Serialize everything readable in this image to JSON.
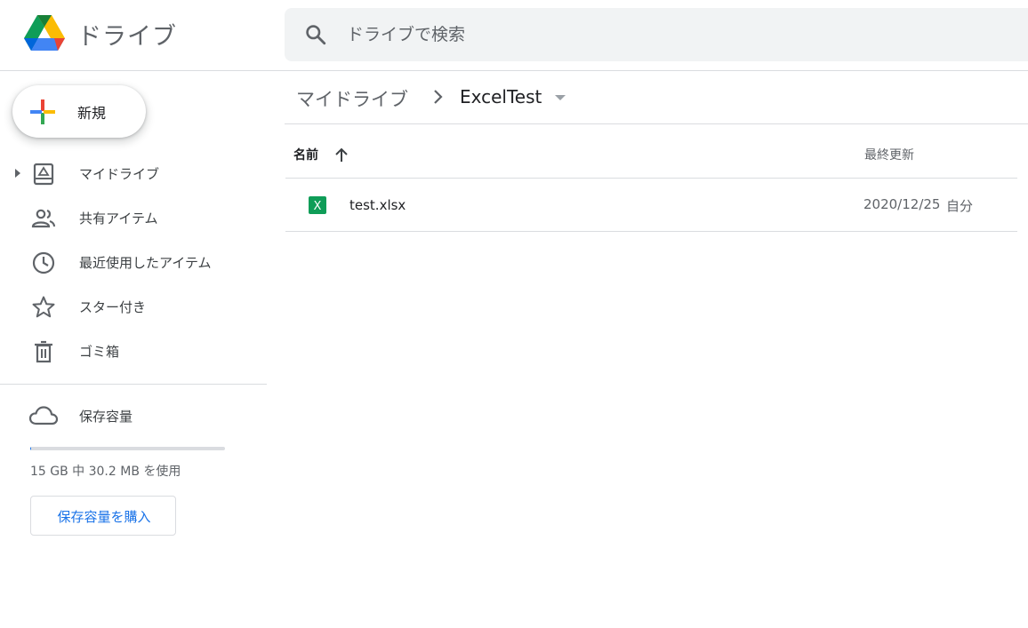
{
  "header": {
    "app_title": "ドライブ",
    "search_placeholder": "ドライブで検索"
  },
  "sidebar": {
    "new_label": "新規",
    "items": [
      {
        "label": "マイドライブ",
        "icon": "my-drive-icon"
      },
      {
        "label": "共有アイテム",
        "icon": "shared-icon"
      },
      {
        "label": "最近使用したアイテム",
        "icon": "clock-icon"
      },
      {
        "label": "スター付き",
        "icon": "star-icon"
      },
      {
        "label": "ゴミ箱",
        "icon": "trash-icon"
      }
    ],
    "storage": {
      "title": "保存容量",
      "usage_text": "15 GB 中 30.2 MB を使用",
      "used_fraction": 0.002,
      "buy_label": "保存容量を購入"
    }
  },
  "breadcrumb": {
    "root": "マイドライブ",
    "current": "ExcelTest"
  },
  "file_list": {
    "columns": {
      "name": "名前",
      "modified": "最終更新"
    },
    "rows": [
      {
        "name": "test.xlsx",
        "date": "2020/12/25",
        "owner": "自分",
        "icon": "xlsx-icon"
      }
    ]
  },
  "colors": {
    "accent": "#1a73e8",
    "excel_green": "#0f9d58",
    "search_bg": "#f1f3f4",
    "divider": "#dadce0"
  }
}
